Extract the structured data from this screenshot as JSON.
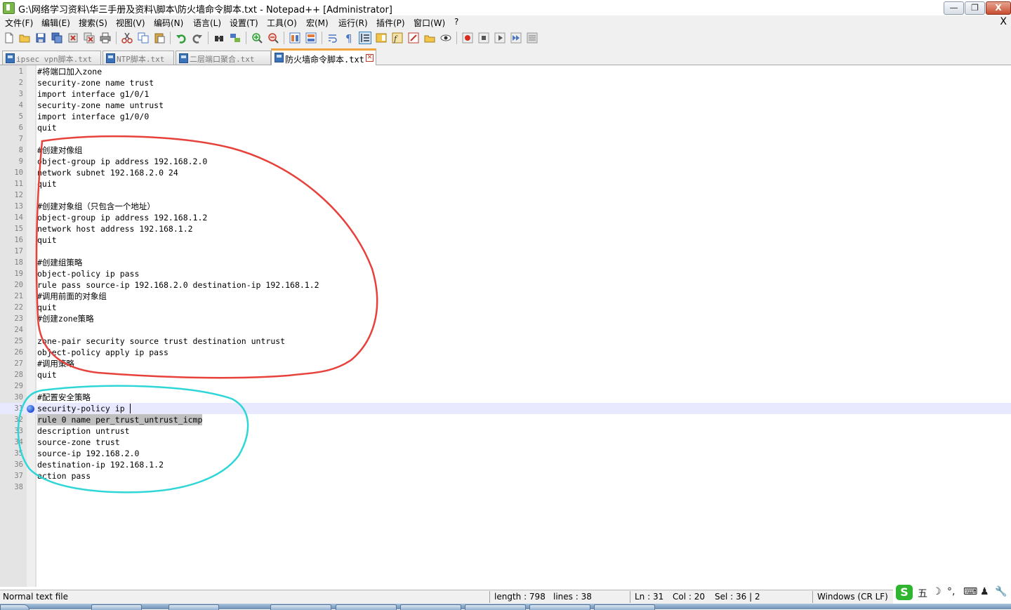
{
  "window": {
    "title": "G:\\网络学习资料\\华三手册及资料\\脚本\\防火墙命令脚本.txt - Notepad++ [Administrator]",
    "controls": {
      "minimize": "—",
      "restore": "❐",
      "close": "X"
    }
  },
  "menu": {
    "items": [
      "文件(F)",
      "编辑(E)",
      "搜索(S)",
      "视图(V)",
      "编码(N)",
      "语言(L)",
      "设置(T)",
      "工具(O)",
      "宏(M)",
      "运行(R)",
      "插件(P)",
      "窗口(W)",
      "?"
    ],
    "close_doc": "X"
  },
  "toolbar": {
    "buttons": [
      "new",
      "open",
      "save",
      "save-all",
      "close",
      "close-all",
      "print",
      "cut",
      "copy",
      "paste",
      "undo",
      "redo",
      "find",
      "replace",
      "zoom-in",
      "zoom-out",
      "sync-vertical",
      "sync-horizontal",
      "word-wrap",
      "show-all-chars",
      "indent-guide",
      "doc-map",
      "function-list",
      "folder-as-workspace",
      "monitoring",
      "record-macro",
      "stop-recording",
      "playback",
      "run-macro-multiple",
      "save-macro"
    ],
    "selected": "indent-guide"
  },
  "tabs": [
    {
      "label": "ipsec vpn脚本.txt",
      "active": false,
      "color": "#3b73b8"
    },
    {
      "label": "NTP脚本.txt",
      "active": false,
      "color": "#3b73b8"
    },
    {
      "label": "二层端口聚合.txt",
      "active": false,
      "color": "#3b73b8"
    },
    {
      "label": "防火墙命令脚本.txt",
      "active": true,
      "color": "#3b73b8"
    }
  ],
  "editor": {
    "current_line": 31,
    "bookmark_line": 31,
    "selected_line": 32,
    "lines": [
      {
        "n": "1",
        "text": "#将端口加入zone"
      },
      {
        "n": "2",
        "text": "security-zone name trust"
      },
      {
        "n": "3",
        "text": "import interface g1/0/1"
      },
      {
        "n": "4",
        "text": "security-zone name untrust"
      },
      {
        "n": "5",
        "text": "import interface g1/0/0"
      },
      {
        "n": "6",
        "text": "quit"
      },
      {
        "n": "7",
        "text": ""
      },
      {
        "n": "8",
        "text": "#创建对像组"
      },
      {
        "n": "9",
        "text": "object-group ip address 192.168.2.0"
      },
      {
        "n": "10",
        "text": "network subnet 192.168.2.0 24"
      },
      {
        "n": "11",
        "text": "quit"
      },
      {
        "n": "12",
        "text": ""
      },
      {
        "n": "13",
        "text": "#创建对象组（只包含一个地址）"
      },
      {
        "n": "14",
        "text": "object-group ip address 192.168.1.2"
      },
      {
        "n": "15",
        "text": "network host address 192.168.1.2"
      },
      {
        "n": "16",
        "text": "quit"
      },
      {
        "n": "17",
        "text": ""
      },
      {
        "n": "18",
        "text": "#创建组策略"
      },
      {
        "n": "19",
        "text": "object-policy ip pass"
      },
      {
        "n": "20",
        "text": "rule pass source-ip 192.168.2.0 destination-ip 192.168.1.2"
      },
      {
        "n": "21",
        "text": "#调用前面的对象组"
      },
      {
        "n": "22",
        "text": "quit"
      },
      {
        "n": "23",
        "text": "#创建zone策略"
      },
      {
        "n": "24",
        "text": ""
      },
      {
        "n": "25",
        "text": "zone-pair security source trust destination untrust"
      },
      {
        "n": "26",
        "text": "object-policy apply ip pass"
      },
      {
        "n": "27",
        "text": "#调用策略"
      },
      {
        "n": "28",
        "text": "quit"
      },
      {
        "n": "29",
        "text": ""
      },
      {
        "n": "30",
        "text": "#配置安全策略"
      },
      {
        "n": "31",
        "text": "security-policy ip "
      },
      {
        "n": "32",
        "text": "rule 0 name per_trust_untrust_icmp"
      },
      {
        "n": "33",
        "text": "description untrust"
      },
      {
        "n": "34",
        "text": "source-zone trust"
      },
      {
        "n": "35",
        "text": "source-ip 192.168.2.0"
      },
      {
        "n": "36",
        "text": "destination-ip 192.168.1.2"
      },
      {
        "n": "37",
        "text": "action pass"
      },
      {
        "n": "38",
        "text": ""
      }
    ]
  },
  "annotations": {
    "red_color": "#e8413c",
    "cyan_color": "#2fd6d8"
  },
  "status": {
    "file_type": "Normal text file",
    "length": "length : 798",
    "lines": "lines : 38",
    "ln": "Ln : 31",
    "col": "Col : 20",
    "sel": "Sel : 36 | 2",
    "eol": "Windows (CR LF)"
  },
  "ime": {
    "logo": "S",
    "symbols": [
      "五",
      "☽",
      "°,",
      "⌨",
      "♟",
      "🔧"
    ]
  }
}
